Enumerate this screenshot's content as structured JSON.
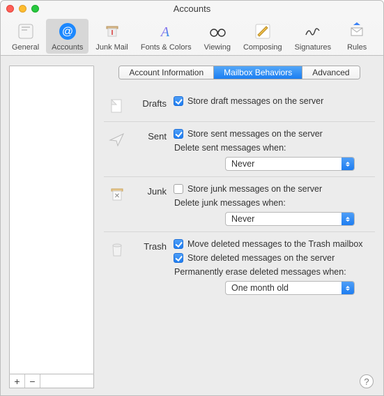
{
  "window": {
    "title": "Accounts"
  },
  "toolbar": {
    "items": [
      {
        "label": "General"
      },
      {
        "label": "Accounts"
      },
      {
        "label": "Junk Mail"
      },
      {
        "label": "Fonts & Colors"
      },
      {
        "label": "Viewing"
      },
      {
        "label": "Composing"
      },
      {
        "label": "Signatures"
      },
      {
        "label": "Rules"
      }
    ],
    "activeIndex": 1
  },
  "tabs": {
    "items": [
      {
        "label": "Account Information"
      },
      {
        "label": "Mailbox Behaviors"
      },
      {
        "label": "Advanced"
      }
    ],
    "activeIndex": 1
  },
  "sections": {
    "drafts": {
      "title": "Drafts",
      "store_label": "Store draft messages on the server",
      "store_checked": true
    },
    "sent": {
      "title": "Sent",
      "store_label": "Store sent messages on the server",
      "store_checked": true,
      "delete_hint": "Delete sent messages when:",
      "delete_value": "Never"
    },
    "junk": {
      "title": "Junk",
      "store_label": "Store junk messages on the server",
      "store_checked": false,
      "delete_hint": "Delete junk messages when:",
      "delete_value": "Never"
    },
    "trash": {
      "title": "Trash",
      "move_label": "Move deleted messages to the Trash mailbox",
      "move_checked": true,
      "store_label": "Store deleted messages on the server",
      "store_checked": true,
      "erase_hint": "Permanently erase deleted messages when:",
      "erase_value": "One month old"
    }
  },
  "footer": {
    "plus": "+",
    "minus": "−"
  },
  "help": "?"
}
